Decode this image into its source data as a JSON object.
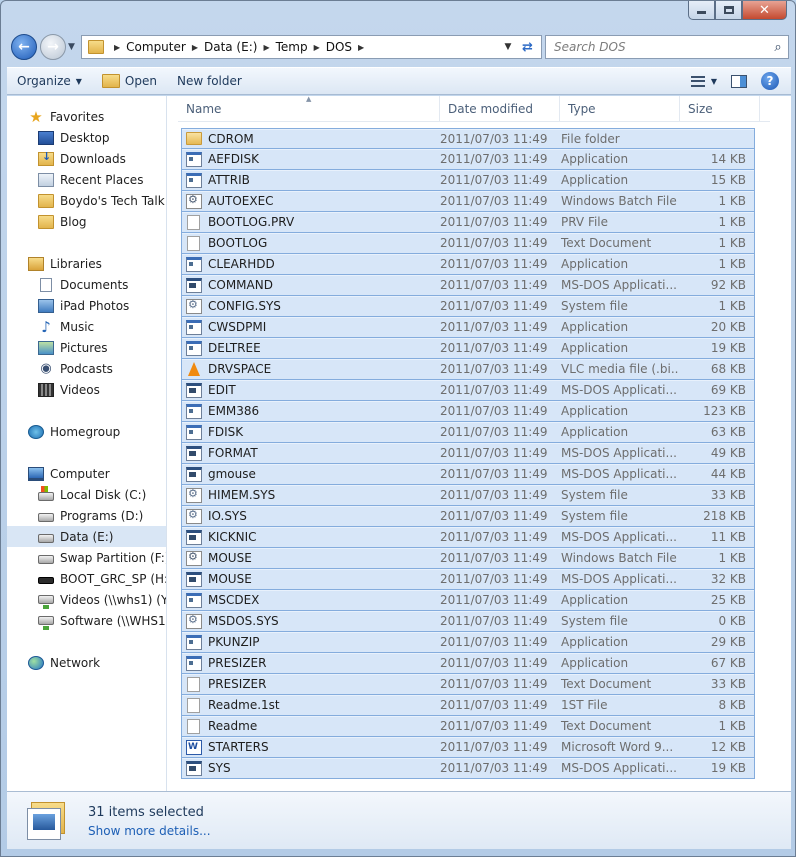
{
  "address": {
    "crumbs": [
      "Computer",
      "Data (E:)",
      "Temp",
      "DOS"
    ],
    "search_placeholder": "Search DOS"
  },
  "toolbar": {
    "organize": "Organize",
    "open": "Open",
    "new_folder": "New folder"
  },
  "nav": {
    "favorites": {
      "label": "Favorites",
      "items": [
        "Desktop",
        "Downloads",
        "Recent Places",
        "Boydo's Tech Talk B",
        "Blog"
      ]
    },
    "libraries": {
      "label": "Libraries",
      "items": [
        "Documents",
        "iPad Photos",
        "Music",
        "Pictures",
        "Podcasts",
        "Videos"
      ]
    },
    "homegroup": "Homegroup",
    "computer": {
      "label": "Computer",
      "items": [
        "Local Disk (C:)",
        "Programs (D:)",
        "Data (E:)",
        "Swap Partition (F:)",
        "BOOT_GRC_SP (H:)",
        "Videos (\\\\whs1) (Y:)",
        "Software (\\\\WHS1) ("
      ]
    },
    "network": "Network"
  },
  "columns": [
    "Name",
    "Date modified",
    "Type",
    "Size"
  ],
  "files": [
    {
      "name": "CDROM",
      "date": "2011/07/03 11:49",
      "type": "File folder",
      "size": "",
      "icon": "folder"
    },
    {
      "name": "AEFDISK",
      "date": "2011/07/03 11:49",
      "type": "Application",
      "size": "14 KB",
      "icon": "app"
    },
    {
      "name": "ATTRIB",
      "date": "2011/07/03 11:49",
      "type": "Application",
      "size": "15 KB",
      "icon": "app"
    },
    {
      "name": "AUTOEXEC",
      "date": "2011/07/03 11:49",
      "type": "Windows Batch File",
      "size": "1 KB",
      "icon": "bat"
    },
    {
      "name": "BOOTLOG.PRV",
      "date": "2011/07/03 11:49",
      "type": "PRV File",
      "size": "1 KB",
      "icon": "txt"
    },
    {
      "name": "BOOTLOG",
      "date": "2011/07/03 11:49",
      "type": "Text Document",
      "size": "1 KB",
      "icon": "txt"
    },
    {
      "name": "CLEARHDD",
      "date": "2011/07/03 11:49",
      "type": "Application",
      "size": "1 KB",
      "icon": "app"
    },
    {
      "name": "COMMAND",
      "date": "2011/07/03 11:49",
      "type": "MS-DOS Applicati...",
      "size": "92 KB",
      "icon": "msdos"
    },
    {
      "name": "CONFIG.SYS",
      "date": "2011/07/03 11:49",
      "type": "System file",
      "size": "1 KB",
      "icon": "sys"
    },
    {
      "name": "CWSDPMI",
      "date": "2011/07/03 11:49",
      "type": "Application",
      "size": "20 KB",
      "icon": "app"
    },
    {
      "name": "DELTREE",
      "date": "2011/07/03 11:49",
      "type": "Application",
      "size": "19 KB",
      "icon": "app"
    },
    {
      "name": "DRVSPACE",
      "date": "2011/07/03 11:49",
      "type": "VLC media file (.bi...",
      "size": "68 KB",
      "icon": "vlc"
    },
    {
      "name": "EDIT",
      "date": "2011/07/03 11:49",
      "type": "MS-DOS Applicati...",
      "size": "69 KB",
      "icon": "msdos"
    },
    {
      "name": "EMM386",
      "date": "2011/07/03 11:49",
      "type": "Application",
      "size": "123 KB",
      "icon": "app"
    },
    {
      "name": "FDISK",
      "date": "2011/07/03 11:49",
      "type": "Application",
      "size": "63 KB",
      "icon": "app"
    },
    {
      "name": "FORMAT",
      "date": "2011/07/03 11:49",
      "type": "MS-DOS Applicati...",
      "size": "49 KB",
      "icon": "msdos"
    },
    {
      "name": "gmouse",
      "date": "2011/07/03 11:49",
      "type": "MS-DOS Applicati...",
      "size": "44 KB",
      "icon": "msdos"
    },
    {
      "name": "HIMEM.SYS",
      "date": "2011/07/03 11:49",
      "type": "System file",
      "size": "33 KB",
      "icon": "sys"
    },
    {
      "name": "IO.SYS",
      "date": "2011/07/03 11:49",
      "type": "System file",
      "size": "218 KB",
      "icon": "sys"
    },
    {
      "name": "KICKNIC",
      "date": "2011/07/03 11:49",
      "type": "MS-DOS Applicati...",
      "size": "11 KB",
      "icon": "msdos"
    },
    {
      "name": "MOUSE",
      "date": "2011/07/03 11:49",
      "type": "Windows Batch File",
      "size": "1 KB",
      "icon": "bat"
    },
    {
      "name": "MOUSE",
      "date": "2011/07/03 11:49",
      "type": "MS-DOS Applicati...",
      "size": "32 KB",
      "icon": "msdos"
    },
    {
      "name": "MSCDEX",
      "date": "2011/07/03 11:49",
      "type": "Application",
      "size": "25 KB",
      "icon": "app"
    },
    {
      "name": "MSDOS.SYS",
      "date": "2011/07/03 11:49",
      "type": "System file",
      "size": "0 KB",
      "icon": "sys"
    },
    {
      "name": "PKUNZIP",
      "date": "2011/07/03 11:49",
      "type": "Application",
      "size": "29 KB",
      "icon": "app"
    },
    {
      "name": "PRESIZER",
      "date": "2011/07/03 11:49",
      "type": "Application",
      "size": "67 KB",
      "icon": "app"
    },
    {
      "name": "PRESIZER",
      "date": "2011/07/03 11:49",
      "type": "Text Document",
      "size": "33 KB",
      "icon": "txt"
    },
    {
      "name": "Readme.1st",
      "date": "2011/07/03 11:49",
      "type": "1ST File",
      "size": "8 KB",
      "icon": "txt"
    },
    {
      "name": "Readme",
      "date": "2011/07/03 11:49",
      "type": "Text Document",
      "size": "1 KB",
      "icon": "txt"
    },
    {
      "name": "STARTERS",
      "date": "2011/07/03 11:49",
      "type": "Microsoft Word 9...",
      "size": "12 KB",
      "icon": "word"
    },
    {
      "name": "SYS",
      "date": "2011/07/03 11:49",
      "type": "MS-DOS Applicati...",
      "size": "19 KB",
      "icon": "msdos"
    }
  ],
  "details": {
    "count": "31 items selected",
    "link": "Show more details..."
  }
}
